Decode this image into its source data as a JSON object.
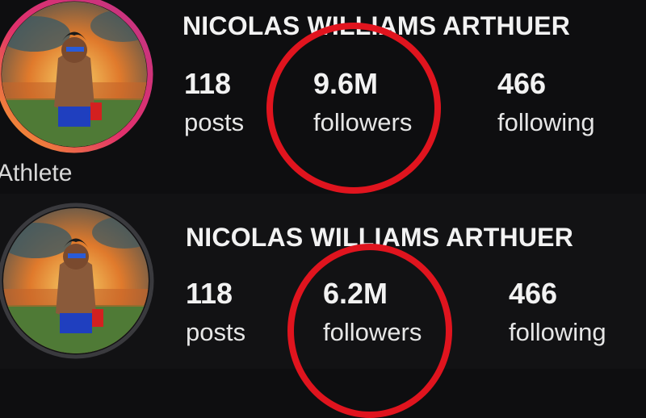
{
  "profiles": [
    {
      "name": "NICOLAS WILLIAMS ARTHUER",
      "category": "Athlete",
      "stats": [
        {
          "value": "118",
          "label": "posts"
        },
        {
          "value": "9.6M",
          "label": "followers"
        },
        {
          "value": "466",
          "label": "following"
        }
      ],
      "story_ring": "gradient"
    },
    {
      "name": "NICOLAS WILLIAMS ARTHUER",
      "stats": [
        {
          "value": "118",
          "label": "posts"
        },
        {
          "value": "6.2M",
          "label": "followers"
        },
        {
          "value": "466",
          "label": "following"
        }
      ],
      "story_ring": "none"
    }
  ],
  "colors": {
    "background": "#0e0e10",
    "annotation_circle": "#e0141e",
    "text": "#f2f2f2"
  },
  "icons": [
    "profile-avatar-icon"
  ]
}
